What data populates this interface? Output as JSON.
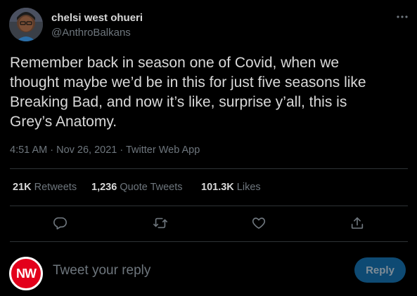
{
  "author": {
    "name": "chelsi west ohueri",
    "handle": "@AnthroBalkans"
  },
  "tweet": {
    "lines": [
      "Remember back in season one of Covid, when we",
      "thought maybe we’d be in this for just five seasons like",
      "Breaking Bad, and now it’s like, surprise y’all, this is",
      "Grey’s Anatomy."
    ],
    "time": "4:51 AM",
    "date": "Nov 26, 2021",
    "source": "Twitter Web App",
    "separator": " · "
  },
  "stats": {
    "retweets": {
      "count": "21K",
      "label": "Retweets"
    },
    "quotes": {
      "count": "1,236",
      "label": "Quote Tweets"
    },
    "likes": {
      "count": "101.3K",
      "label": "Likes"
    }
  },
  "actions": {
    "icons": [
      "reply-icon",
      "retweet-icon",
      "like-icon",
      "share-icon"
    ]
  },
  "composer": {
    "avatar_text": "NW",
    "placeholder": "Tweet your reply",
    "button_label": "Reply"
  },
  "colors": {
    "background": "#000000",
    "text": "#d9d9d9",
    "secondary": "#6e767d",
    "divider": "#2f3336",
    "reply_button": "#0e4a73",
    "nw_red": "#e3001b"
  }
}
